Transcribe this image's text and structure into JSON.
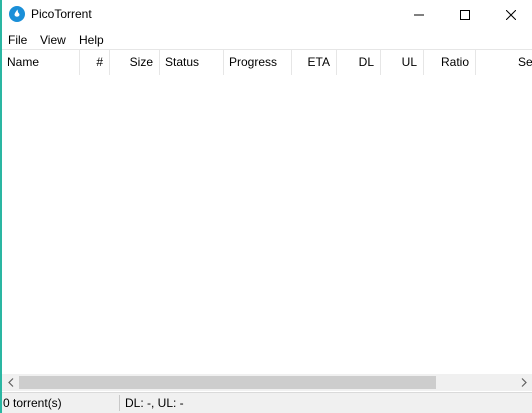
{
  "window": {
    "title": "PicoTorrent"
  },
  "menu": {
    "items": [
      "File",
      "View",
      "Help"
    ]
  },
  "columns": [
    "Name",
    "#",
    "Size",
    "Status",
    "Progress",
    "ETA",
    "DL",
    "UL",
    "Ratio",
    "Se"
  ],
  "status": {
    "torrents": "0 torrent(s)",
    "speeds": "DL: -, UL: -"
  },
  "colors": {
    "accent": "#2ab6a2",
    "app_icon": "#1a8fd8",
    "scrollbar_thumb": "#cdcdcd"
  }
}
